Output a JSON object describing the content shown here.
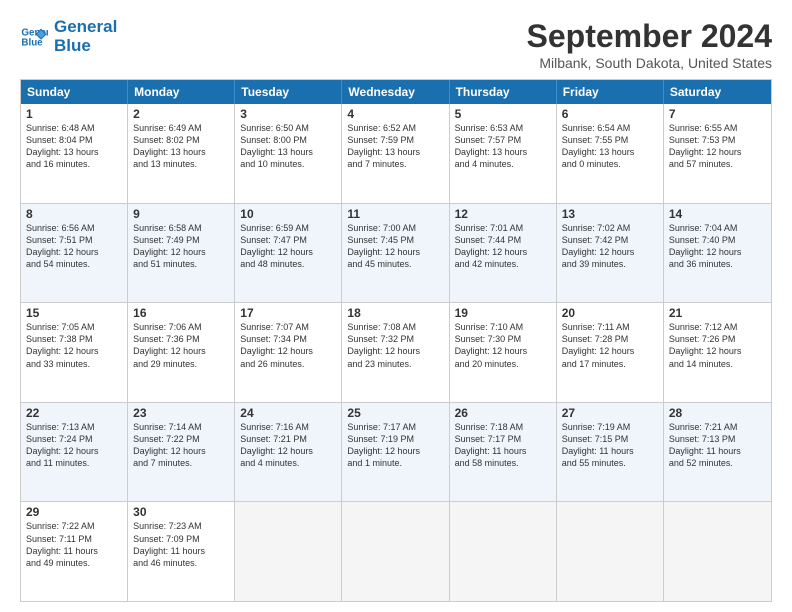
{
  "logo": {
    "line1": "General",
    "line2": "Blue"
  },
  "title": "September 2024",
  "location": "Milbank, South Dakota, United States",
  "headers": [
    "Sunday",
    "Monday",
    "Tuesday",
    "Wednesday",
    "Thursday",
    "Friday",
    "Saturday"
  ],
  "rows": [
    [
      {
        "day": "1",
        "info": "Sunrise: 6:48 AM\nSunset: 8:04 PM\nDaylight: 13 hours\nand 16 minutes."
      },
      {
        "day": "2",
        "info": "Sunrise: 6:49 AM\nSunset: 8:02 PM\nDaylight: 13 hours\nand 13 minutes."
      },
      {
        "day": "3",
        "info": "Sunrise: 6:50 AM\nSunset: 8:00 PM\nDaylight: 13 hours\nand 10 minutes."
      },
      {
        "day": "4",
        "info": "Sunrise: 6:52 AM\nSunset: 7:59 PM\nDaylight: 13 hours\nand 7 minutes."
      },
      {
        "day": "5",
        "info": "Sunrise: 6:53 AM\nSunset: 7:57 PM\nDaylight: 13 hours\nand 4 minutes."
      },
      {
        "day": "6",
        "info": "Sunrise: 6:54 AM\nSunset: 7:55 PM\nDaylight: 13 hours\nand 0 minutes."
      },
      {
        "day": "7",
        "info": "Sunrise: 6:55 AM\nSunset: 7:53 PM\nDaylight: 12 hours\nand 57 minutes."
      }
    ],
    [
      {
        "day": "8",
        "info": "Sunrise: 6:56 AM\nSunset: 7:51 PM\nDaylight: 12 hours\nand 54 minutes."
      },
      {
        "day": "9",
        "info": "Sunrise: 6:58 AM\nSunset: 7:49 PM\nDaylight: 12 hours\nand 51 minutes."
      },
      {
        "day": "10",
        "info": "Sunrise: 6:59 AM\nSunset: 7:47 PM\nDaylight: 12 hours\nand 48 minutes."
      },
      {
        "day": "11",
        "info": "Sunrise: 7:00 AM\nSunset: 7:45 PM\nDaylight: 12 hours\nand 45 minutes."
      },
      {
        "day": "12",
        "info": "Sunrise: 7:01 AM\nSunset: 7:44 PM\nDaylight: 12 hours\nand 42 minutes."
      },
      {
        "day": "13",
        "info": "Sunrise: 7:02 AM\nSunset: 7:42 PM\nDaylight: 12 hours\nand 39 minutes."
      },
      {
        "day": "14",
        "info": "Sunrise: 7:04 AM\nSunset: 7:40 PM\nDaylight: 12 hours\nand 36 minutes."
      }
    ],
    [
      {
        "day": "15",
        "info": "Sunrise: 7:05 AM\nSunset: 7:38 PM\nDaylight: 12 hours\nand 33 minutes."
      },
      {
        "day": "16",
        "info": "Sunrise: 7:06 AM\nSunset: 7:36 PM\nDaylight: 12 hours\nand 29 minutes."
      },
      {
        "day": "17",
        "info": "Sunrise: 7:07 AM\nSunset: 7:34 PM\nDaylight: 12 hours\nand 26 minutes."
      },
      {
        "day": "18",
        "info": "Sunrise: 7:08 AM\nSunset: 7:32 PM\nDaylight: 12 hours\nand 23 minutes."
      },
      {
        "day": "19",
        "info": "Sunrise: 7:10 AM\nSunset: 7:30 PM\nDaylight: 12 hours\nand 20 minutes."
      },
      {
        "day": "20",
        "info": "Sunrise: 7:11 AM\nSunset: 7:28 PM\nDaylight: 12 hours\nand 17 minutes."
      },
      {
        "day": "21",
        "info": "Sunrise: 7:12 AM\nSunset: 7:26 PM\nDaylight: 12 hours\nand 14 minutes."
      }
    ],
    [
      {
        "day": "22",
        "info": "Sunrise: 7:13 AM\nSunset: 7:24 PM\nDaylight: 12 hours\nand 11 minutes."
      },
      {
        "day": "23",
        "info": "Sunrise: 7:14 AM\nSunset: 7:22 PM\nDaylight: 12 hours\nand 7 minutes."
      },
      {
        "day": "24",
        "info": "Sunrise: 7:16 AM\nSunset: 7:21 PM\nDaylight: 12 hours\nand 4 minutes."
      },
      {
        "day": "25",
        "info": "Sunrise: 7:17 AM\nSunset: 7:19 PM\nDaylight: 12 hours\nand 1 minute."
      },
      {
        "day": "26",
        "info": "Sunrise: 7:18 AM\nSunset: 7:17 PM\nDaylight: 11 hours\nand 58 minutes."
      },
      {
        "day": "27",
        "info": "Sunrise: 7:19 AM\nSunset: 7:15 PM\nDaylight: 11 hours\nand 55 minutes."
      },
      {
        "day": "28",
        "info": "Sunrise: 7:21 AM\nSunset: 7:13 PM\nDaylight: 11 hours\nand 52 minutes."
      }
    ],
    [
      {
        "day": "29",
        "info": "Sunrise: 7:22 AM\nSunset: 7:11 PM\nDaylight: 11 hours\nand 49 minutes."
      },
      {
        "day": "30",
        "info": "Sunrise: 7:23 AM\nSunset: 7:09 PM\nDaylight: 11 hours\nand 46 minutes."
      },
      {
        "day": "",
        "info": ""
      },
      {
        "day": "",
        "info": ""
      },
      {
        "day": "",
        "info": ""
      },
      {
        "day": "",
        "info": ""
      },
      {
        "day": "",
        "info": ""
      }
    ]
  ]
}
